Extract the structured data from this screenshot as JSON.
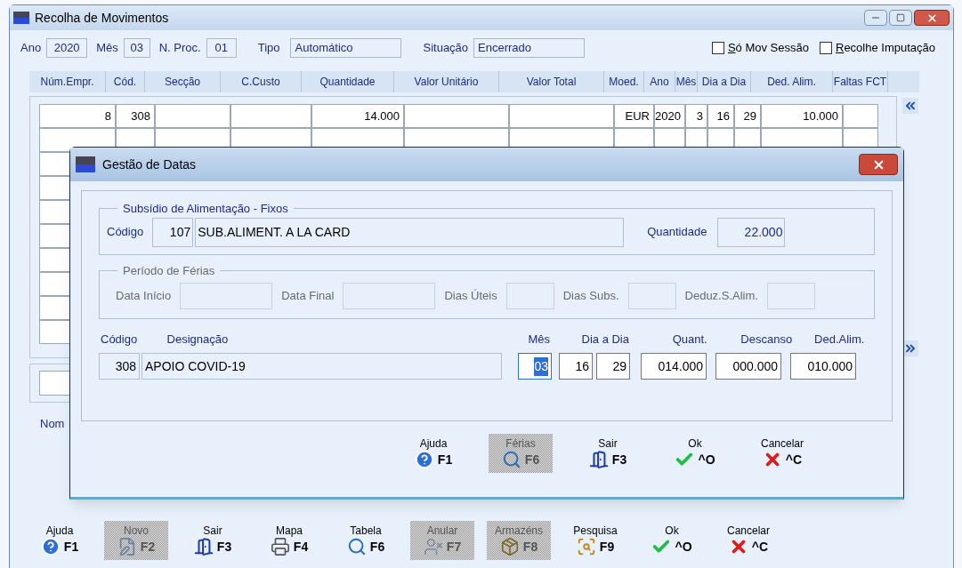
{
  "window": {
    "title": "Recolha de Movimentos"
  },
  "header": {
    "fields": [
      {
        "label": "Ano",
        "value": "2020"
      },
      {
        "label": "Mês",
        "value": "03"
      },
      {
        "label": "N. Proc.",
        "value": "01"
      },
      {
        "label": "Tipo",
        "value": "Automático"
      },
      {
        "label": "Situação",
        "value": "Encerrado"
      }
    ],
    "checkboxes": [
      {
        "label": "Só Mov Sessão",
        "checked": false
      },
      {
        "label": "Recolhe Imputação",
        "checked": false
      }
    ]
  },
  "table": {
    "columns": [
      "Núm.Empr.",
      "Cód.",
      "Secção",
      "C.Custo",
      "Quantidade",
      "Valor Unitário",
      "Valor Total",
      "Moed.",
      "Ano",
      "Mês",
      "Dia a Dia",
      "Ded. Alim.",
      "Faltas FCT"
    ],
    "rows": [
      {
        "cells": [
          {
            "text": "8"
          },
          {
            "text": "308"
          },
          {},
          {},
          {
            "text": "14.000"
          },
          {},
          {},
          {
            "text": "EUR"
          },
          {
            "text": "2020"
          },
          {
            "text": "3"
          },
          {
            "text": "16"
          },
          {
            "text": "29"
          },
          {
            "text": "10.000"
          },
          {}
        ]
      }
    ]
  },
  "name_label": "Nom",
  "dialog": {
    "title": "Gestão de Datas",
    "fixed_subsidy": {
      "legend": "Subsídio de Alimentação - Fixos",
      "code_label": "Código",
      "code": "107",
      "description": "SUB.ALIMENT. A LA CARD",
      "quantity_label": "Quantidade",
      "quantity": "22.000"
    },
    "vacation": {
      "legend": "Período de Férias",
      "disabled": true,
      "fields": [
        {
          "label": "Data Início"
        },
        {
          "label": "Data Final"
        },
        {
          "label": "Dias Úteis"
        },
        {
          "label": "Dias Subs."
        },
        {
          "label": "Deduz.S.Alim."
        }
      ]
    },
    "entry": {
      "labels": [
        "Código",
        "Designação",
        "Mês",
        "Dia a Dia",
        "Quant.",
        "Descanso",
        "Ded.Alim."
      ],
      "fields": [
        {
          "kind": "readonly",
          "value": "308"
        },
        {
          "kind": "readonly",
          "value": "APOIO COVID-19"
        },
        {
          "kind": "input",
          "value": "03",
          "selected": true
        },
        {
          "kind": "input",
          "value": "16",
          "selected": false
        },
        {
          "kind": "input",
          "value": "29",
          "selected": false
        },
        {
          "kind": "input",
          "value": "014.000",
          "selected": false
        },
        {
          "kind": "input",
          "value": "000.000",
          "selected": false
        },
        {
          "kind": "input",
          "value": "010.000",
          "selected": false
        }
      ]
    },
    "buttons": [
      {
        "label": "Ajuda",
        "key": "F1",
        "kind": "help",
        "disabled": false
      },
      {
        "label": "Férias",
        "key": "F6",
        "kind": "table",
        "disabled": true
      },
      {
        "label": "Sair",
        "key": "F3",
        "kind": "exit",
        "disabled": false
      },
      {
        "label": "Ok",
        "key": "^O",
        "kind": "ok",
        "disabled": false
      },
      {
        "label": "Cancelar",
        "key": "^C",
        "kind": "cancel",
        "disabled": false
      }
    ]
  },
  "toolbar": [
    {
      "label": "Ajuda",
      "key": "F1",
      "kind": "help",
      "disabled": false
    },
    {
      "label": "Novo",
      "key": "F2",
      "kind": "new",
      "disabled": true
    },
    {
      "label": "Sair",
      "key": "F3",
      "kind": "exit",
      "disabled": false
    },
    {
      "label": "Mapa",
      "key": "F4",
      "kind": "print",
      "disabled": false
    },
    {
      "label": "Tabela",
      "key": "F6",
      "kind": "table",
      "disabled": false
    },
    {
      "label": "Anular",
      "key": "F7",
      "kind": "void",
      "disabled": true
    },
    {
      "label": "Armazéns",
      "key": "F8",
      "kind": "warehouse",
      "disabled": true
    },
    {
      "label": "Pesquisa",
      "key": "F9",
      "kind": "search",
      "disabled": false
    },
    {
      "label": "Ok",
      "key": "^O",
      "kind": "ok",
      "disabled": false
    },
    {
      "label": "Cancelar",
      "key": "^C",
      "kind": "cancel",
      "disabled": false
    }
  ]
}
